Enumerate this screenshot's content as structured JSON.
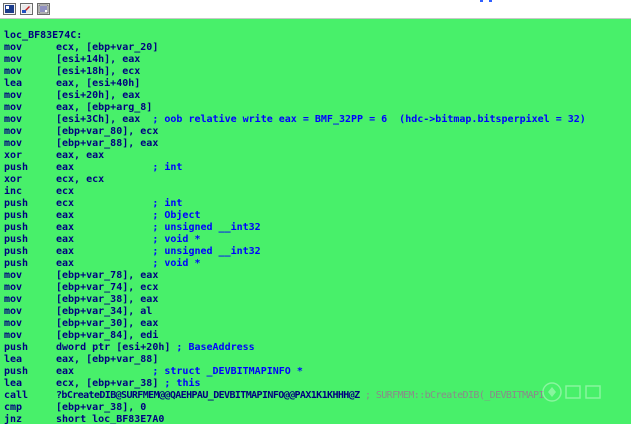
{
  "toolbar": {
    "buttons": [
      {
        "name": "graph-view-icon"
      },
      {
        "name": "edit-icon"
      },
      {
        "name": "function-calls-icon"
      }
    ]
  },
  "label": "loc_BF83E74C:",
  "lines": [
    {
      "m": "mov",
      "o": "ecx, [ebp+var_20]",
      "c": ""
    },
    {
      "m": "mov",
      "o": "[esi+14h], eax",
      "c": ""
    },
    {
      "m": "mov",
      "o": "[esi+18h], ecx",
      "c": ""
    },
    {
      "m": "lea",
      "o": "eax, [esi+40h]",
      "c": ""
    },
    {
      "m": "mov",
      "o": "[esi+20h], eax",
      "c": ""
    },
    {
      "m": "mov",
      "o": "eax, [ebp+arg_8]",
      "c": ""
    },
    {
      "m": "mov",
      "o": "[esi+3Ch], eax",
      "c": "  ; oob relative write eax = BMF_32PP = 6  (hdc->bitmap.bitsperpixel = 32)"
    },
    {
      "m": "mov",
      "o": "[ebp+var_80], ecx",
      "c": ""
    },
    {
      "m": "mov",
      "o": "[ebp+var_88], eax",
      "c": ""
    },
    {
      "m": "xor",
      "o": "eax, eax",
      "c": ""
    },
    {
      "m": "push",
      "o": "eax",
      "c": "             ; int"
    },
    {
      "m": "xor",
      "o": "ecx, ecx",
      "c": ""
    },
    {
      "m": "inc",
      "o": "ecx",
      "c": ""
    },
    {
      "m": "push",
      "o": "ecx",
      "c": "             ; int"
    },
    {
      "m": "push",
      "o": "eax",
      "c": "             ; Object"
    },
    {
      "m": "push",
      "o": "eax",
      "c": "             ; unsigned __int32"
    },
    {
      "m": "push",
      "o": "eax",
      "c": "             ; void *"
    },
    {
      "m": "push",
      "o": "eax",
      "c": "             ; unsigned __int32"
    },
    {
      "m": "push",
      "o": "eax",
      "c": "             ; void *"
    },
    {
      "m": "mov",
      "o": "[ebp+var_78], eax",
      "c": ""
    },
    {
      "m": "mov",
      "o": "[ebp+var_74], ecx",
      "c": ""
    },
    {
      "m": "mov",
      "o": "[ebp+var_38], eax",
      "c": ""
    },
    {
      "m": "mov",
      "o": "[ebp+var_34], al",
      "c": ""
    },
    {
      "m": "mov",
      "o": "[ebp+var_30], eax",
      "c": ""
    },
    {
      "m": "mov",
      "o": "[ebp+var_84], edi",
      "c": ""
    },
    {
      "m": "push",
      "o": "dword ptr [esi+20h]",
      "c": " ; BaseAddress"
    },
    {
      "m": "lea",
      "o": "eax, [ebp+var_88]",
      "c": ""
    },
    {
      "m": "push",
      "o": "eax",
      "c": "             ; struct _DEVBITMAPINFO *"
    },
    {
      "m": "lea",
      "o": "ecx, [ebp+var_38]",
      "c": " ; this"
    },
    {
      "m": "call",
      "o": "?bCreateDIB@SURFMEM@@QAEHPAU_DEVBITMAPINFO@@PAX1K1KHHH@Z",
      "c": "",
      "t": " ; SURFMEM::bCreateDIB(_DEVBITMAPI"
    },
    {
      "m": "cmp",
      "o": "[ebp+var_38], 0",
      "c": ""
    },
    {
      "m": "jnz",
      "o": "short loc_BF83E7A0",
      "c": ""
    }
  ],
  "colors": {
    "background": "#48f06a",
    "code": "#000080",
    "comment": "#0000ff",
    "toolbar": "#ffffff"
  }
}
